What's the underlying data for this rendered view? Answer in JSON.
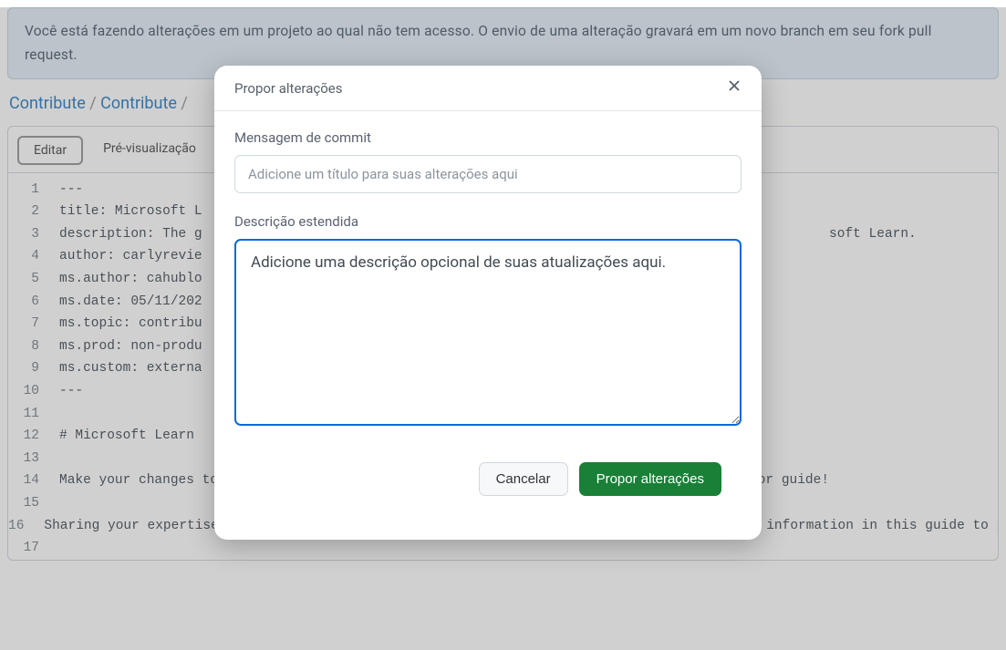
{
  "banner": {
    "text": "Você está fazendo alterações em um projeto ao qual não tem acesso. O envio de uma alteração gravará em um novo branch em seu fork pull request."
  },
  "breadcrumb": {
    "items": [
      "Contribute",
      "Contribute"
    ],
    "sep": " / "
  },
  "tabs": {
    "edit": "Editar",
    "preview": "Pré-visualização"
  },
  "code": {
    "lines": [
      "---",
      "title: Microsoft L",
      "description: The g                                                                               soft Learn.",
      "author: carlyrevie",
      "ms.author: cahublo",
      "ms.date: 05/11/202",
      "ms.topic: contribu",
      "ms.prod: non-produ",
      "ms.custom: externa",
      "---",
      "",
      "# Microsoft Learn ",
      "",
      "Make your changes to the article. Welcome to the Microsoft Learn documentation contributor guide!",
      "",
      "Sharing your expertise with others on Microsoft Learn helps everyone achieve more. Use the information in this guide to publish make updates to an existing published article.",
      ""
    ]
  },
  "modal": {
    "title": "Propor alterações",
    "commit_label": "Mensagem de commit",
    "commit_placeholder": "Adicione um título para suas alterações aqui",
    "desc_label": "Descrição estendida",
    "desc_placeholder": "Adicione uma descrição opcional de suas atualizações aqui.",
    "cancel": "Cancelar",
    "submit": "Propor alterações"
  }
}
